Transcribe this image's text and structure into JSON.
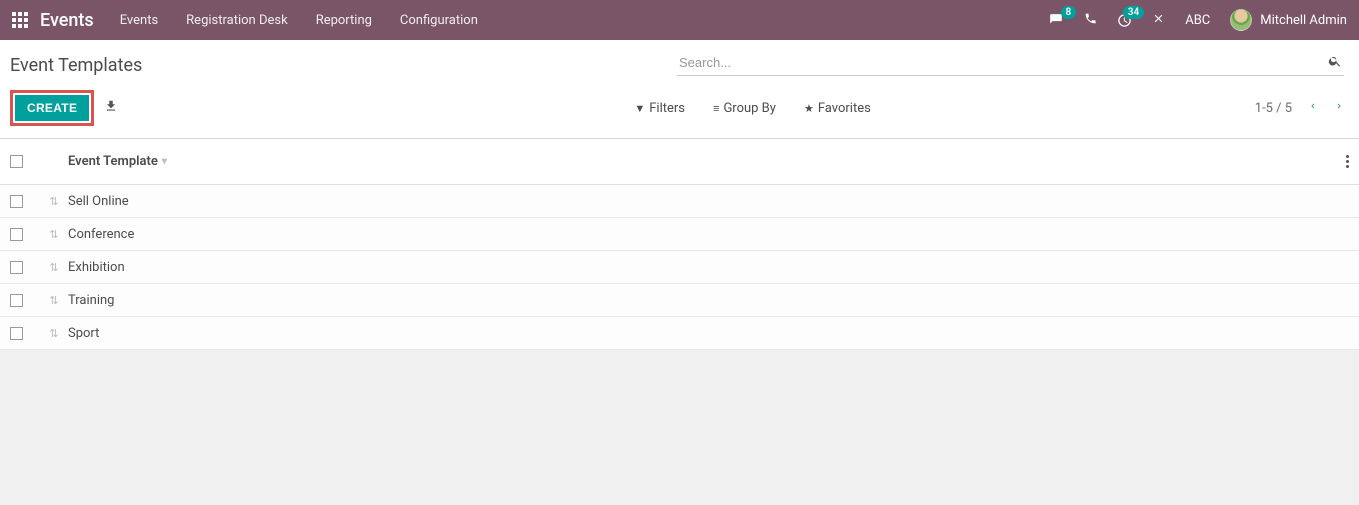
{
  "topbar": {
    "brand": "Events",
    "nav": [
      "Events",
      "Registration Desk",
      "Reporting",
      "Configuration"
    ],
    "messages_badge": "8",
    "activities_badge": "34",
    "company": "ABC",
    "username": "Mitchell Admin"
  },
  "control_panel": {
    "title": "Event Templates",
    "search_placeholder": "Search...",
    "create_label": "CREATE",
    "filters_label": "Filters",
    "group_by_label": "Group By",
    "favorites_label": "Favorites",
    "pager": "1-5 / 5"
  },
  "list": {
    "column_header": "Event Template",
    "rows": [
      {
        "name": "Sell Online"
      },
      {
        "name": "Conference"
      },
      {
        "name": "Exhibition"
      },
      {
        "name": "Training"
      },
      {
        "name": "Sport"
      }
    ]
  }
}
